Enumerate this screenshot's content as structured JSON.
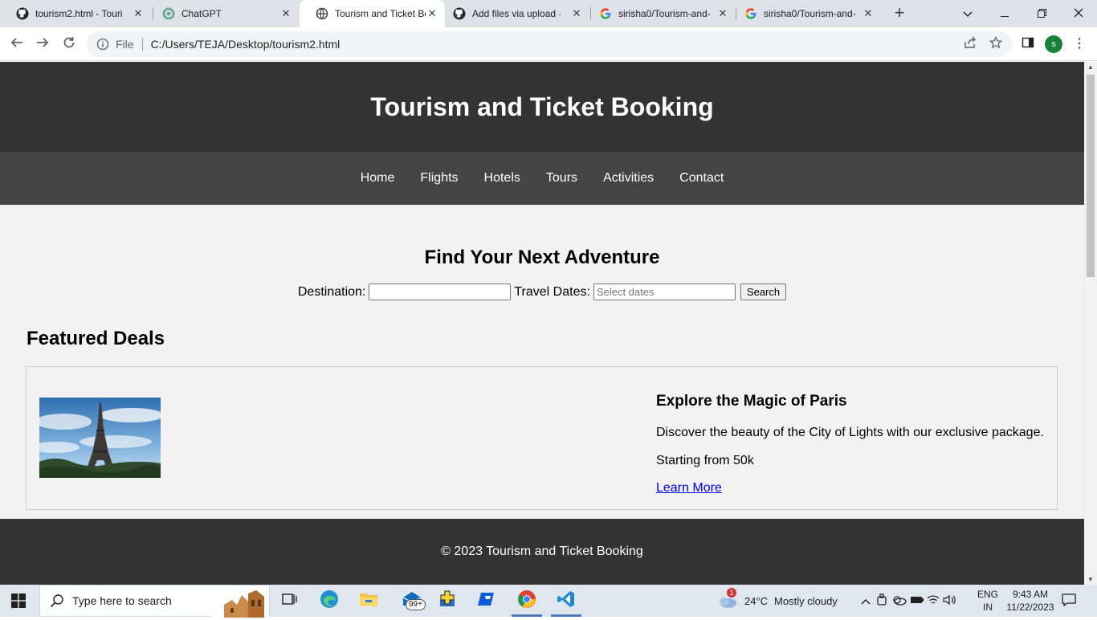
{
  "browser": {
    "tabs": [
      {
        "title": "tourism2.html - Touri",
        "icon": "github-icon"
      },
      {
        "title": "ChatGPT",
        "icon": "chatgpt-icon"
      },
      {
        "title": "Tourism and Ticket Bo",
        "icon": "globe-icon",
        "active": true
      },
      {
        "title": "Add files via upload ·",
        "icon": "github-icon"
      },
      {
        "title": "sirisha0/Tourism-and-",
        "icon": "google-icon"
      },
      {
        "title": "sirisha0/Tourism-and-",
        "icon": "google-icon"
      }
    ],
    "close_glyph": "✕",
    "new_tab_glyph": "+",
    "address": {
      "scheme_label": "File",
      "url": "C:/Users/TEJA/Desktop/tourism2.html"
    },
    "profile_initial": "s"
  },
  "site": {
    "title": "Tourism and Ticket Booking",
    "nav": [
      "Home",
      "Flights",
      "Hotels",
      "Tours",
      "Activities",
      "Contact"
    ],
    "search": {
      "heading": "Find Your Next Adventure",
      "destination_label": "Destination:",
      "destination_value": "",
      "dates_label": "Travel Dates:",
      "dates_placeholder": "Select dates",
      "button": "Search"
    },
    "featured": {
      "heading": "Featured Deals",
      "deal": {
        "title": "Explore the Magic of Paris",
        "description": "Discover the beauty of the City of Lights with our exclusive package.",
        "price": "Starting from 50k",
        "link": "Learn More"
      }
    },
    "footer": "© 2023 Tourism and Ticket Booking"
  },
  "taskbar": {
    "search_placeholder": "Type here to search",
    "mail_badge": "99+",
    "weather": {
      "temp": "24°C",
      "desc": "Mostly cloudy",
      "alert": "1"
    },
    "lang": {
      "line1": "ENG",
      "line2": "IN"
    },
    "clock": {
      "time": "9:43 AM",
      "date": "11/22/2023"
    }
  },
  "colors": {
    "header_bg": "#333333",
    "nav_bg": "#444444",
    "page_bg": "#f2f2f2",
    "link": "#0000ee"
  }
}
